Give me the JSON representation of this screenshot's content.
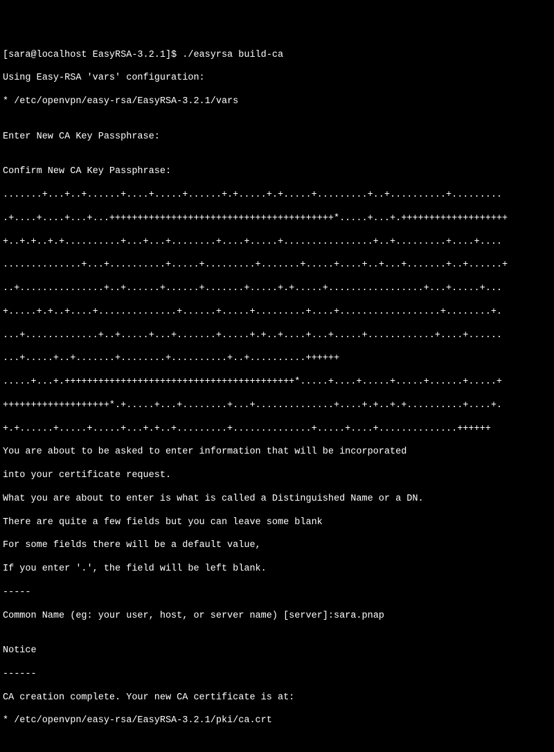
{
  "prompt": {
    "user_host_dir": "[sara@localhost EasyRSA-3.2.1]$ ",
    "command": "./easyrsa build-ca"
  },
  "lines": {
    "l1": "Using Easy-RSA 'vars' configuration:",
    "l2": "* /etc/openvpn/easy-rsa/EasyRSA-3.2.1/vars",
    "l3": "",
    "l4": "Enter New CA Key Passphrase:",
    "l5": "",
    "l6": "Confirm New CA Key Passphrase:",
    "l7": ".......+...+..+......+....+.....+......+.+.....+.+.....+.........+..+..........+.........",
    "l8": ".+....+....+...+...++++++++++++++++++++++++++++++++++++++++*.....+...+.+++++++++++++++++++",
    "l9": "+..+.+..+.+..........+...+...+........+....+.....+................+..+.........+....+....",
    "l10": "..............+...+..........+.....+.........+.......+.....+....+..+...+.......+..+......+",
    "l11": "..+...............+..+......+......+.......+.....+.+.....+.................+...+.....+...",
    "l12": "+.....+.+..+....+..............+......+.....+.........+....+..................+........+.",
    "l13": "...+.............+..+.....+...+.......+.....+.+..+....+...+.....+............+....+......",
    "l14": "...+.....+..+.......+........+..........+..+..........++++++",
    "l15": ".....+...+.+++++++++++++++++++++++++++++++++++++++++*.....+....+.....+.....+......+.....+",
    "l16": "+++++++++++++++++++*.+.....+...+........+...+..............+....+.+..+.+..........+....+.",
    "l17": "+.+......+.....+.....+...+.+..+.........+..............+.....+....+..............++++++",
    "l18": "You are about to be asked to enter information that will be incorporated",
    "l19": "into your certificate request.",
    "l20": "What you are about to enter is what is called a Distinguished Name or a DN.",
    "l21": "There are quite a few fields but you can leave some blank",
    "l22": "For some fields there will be a default value,",
    "l23": "If you enter '.', the field will be left blank.",
    "l24": "-----",
    "l25_prompt": "Common Name (eg: your user, host, or server name) [server]:",
    "l25_input": "sara.pnap",
    "l26": "",
    "l27": "Notice",
    "l28": "------",
    "l29": "CA creation complete. Your new CA certificate is at:",
    "l30": "* /etc/openvpn/easy-rsa/EasyRSA-3.2.1/pki/ca.crt"
  }
}
